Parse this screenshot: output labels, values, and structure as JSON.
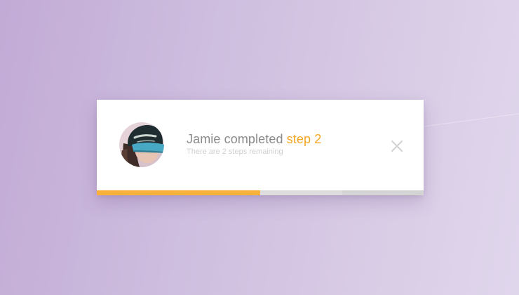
{
  "notification": {
    "title_prefix": "Jamie completed ",
    "title_step": "step 2",
    "subtitle": "There are 2 steps remaining",
    "avatar_icon": "user-photo-avatar",
    "close_icon": "close-icon"
  },
  "progress": {
    "completed_steps": 2,
    "total_steps": 4,
    "segments": [
      {
        "name": "step-1",
        "status": "completed",
        "color": "#f8b13a"
      },
      {
        "name": "step-2",
        "status": "completed",
        "color": "#f8b13a"
      },
      {
        "name": "step-3",
        "status": "remaining",
        "color": "#dddddd"
      },
      {
        "name": "step-4",
        "status": "remaining",
        "color": "#d4d4d4"
      }
    ]
  },
  "colors": {
    "accent": "#f5a623",
    "title_text": "#8a8a8a",
    "subtitle_text": "#d0d0d0",
    "card_background": "#ffffff"
  }
}
